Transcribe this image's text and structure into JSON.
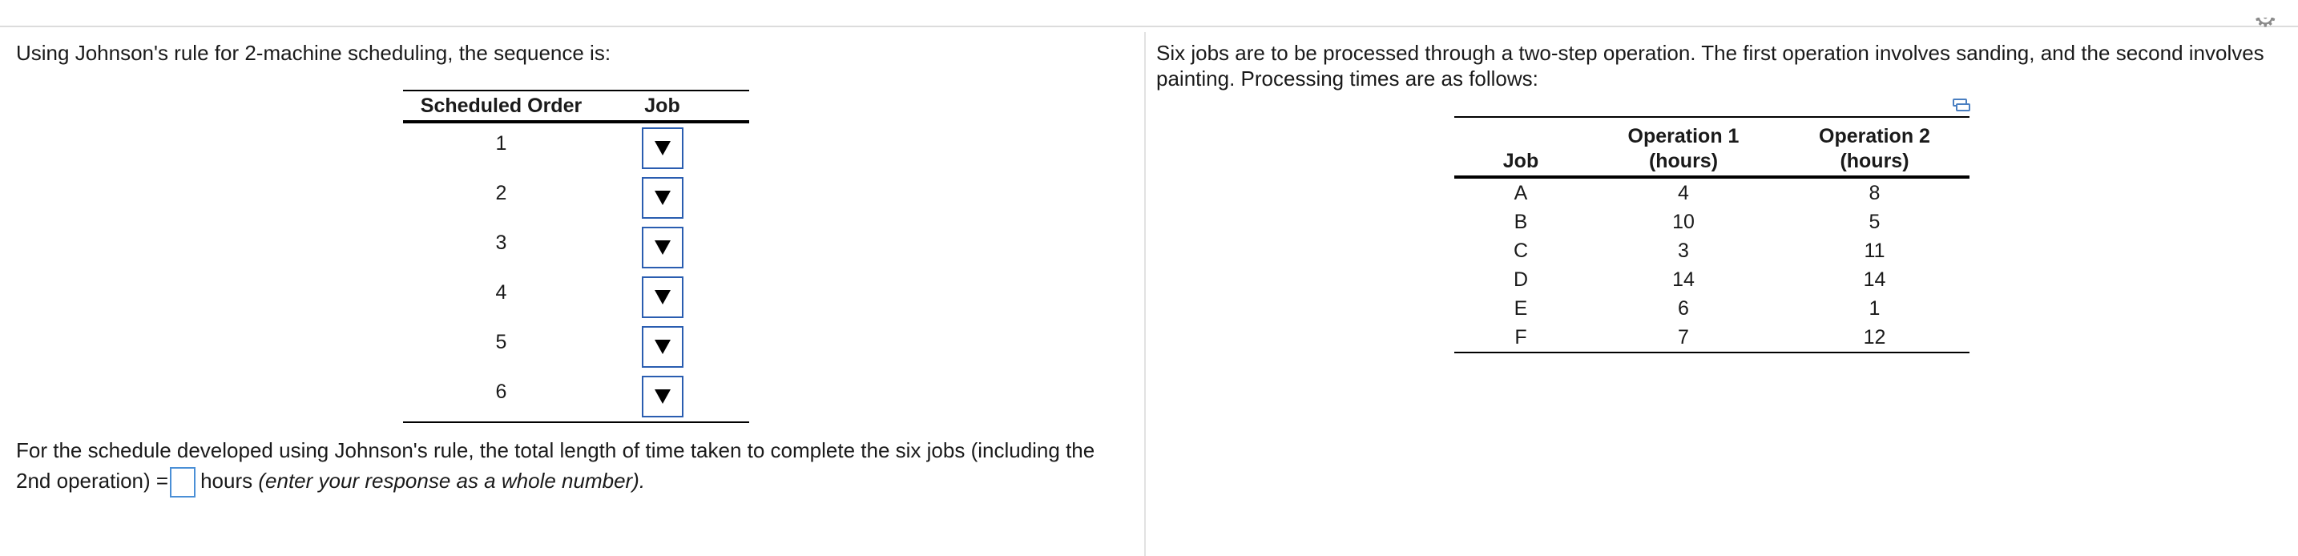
{
  "left": {
    "question": "Using Johnson's rule for 2-machine scheduling, the sequence is:",
    "schedule_table": {
      "headers": {
        "order": "Scheduled Order",
        "job": "Job"
      },
      "rows": [
        {
          "order": "1"
        },
        {
          "order": "2"
        },
        {
          "order": "3"
        },
        {
          "order": "4"
        },
        {
          "order": "5"
        },
        {
          "order": "6"
        }
      ]
    },
    "answer": {
      "before": "For the schedule developed using Johnson's rule, the total length of time taken to complete the six jobs (including the 2nd operation) =",
      "unit": "hours",
      "hint": "(enter your response as a whole number)."
    }
  },
  "right": {
    "intro": "Six jobs are to be processed through a two-step operation.  The first operation involves sanding, and the second involves painting. Processing times are as follows:",
    "table": {
      "headers": {
        "job": "Job",
        "op1_line1": "Operation 1",
        "op1_line2": "(hours)",
        "op2_line1": "Operation 2",
        "op2_line2": "(hours)"
      },
      "rows": [
        {
          "job": "A",
          "op1": "4",
          "op2": "8"
        },
        {
          "job": "B",
          "op1": "10",
          "op2": "5"
        },
        {
          "job": "C",
          "op1": "3",
          "op2": "11"
        },
        {
          "job": "D",
          "op1": "14",
          "op2": "14"
        },
        {
          "job": "E",
          "op1": "6",
          "op2": "1"
        },
        {
          "job": "F",
          "op1": "7",
          "op2": "12"
        }
      ]
    }
  },
  "icons": {
    "dropdown": "dropdown-arrow-icon",
    "copy": "copy-to-clipboard-icon",
    "settings": "gear-icon"
  },
  "colors": {
    "input_border": "#2a5db0",
    "answer_box_border": "#4a8fd6",
    "divider": "#e2e2e2"
  }
}
